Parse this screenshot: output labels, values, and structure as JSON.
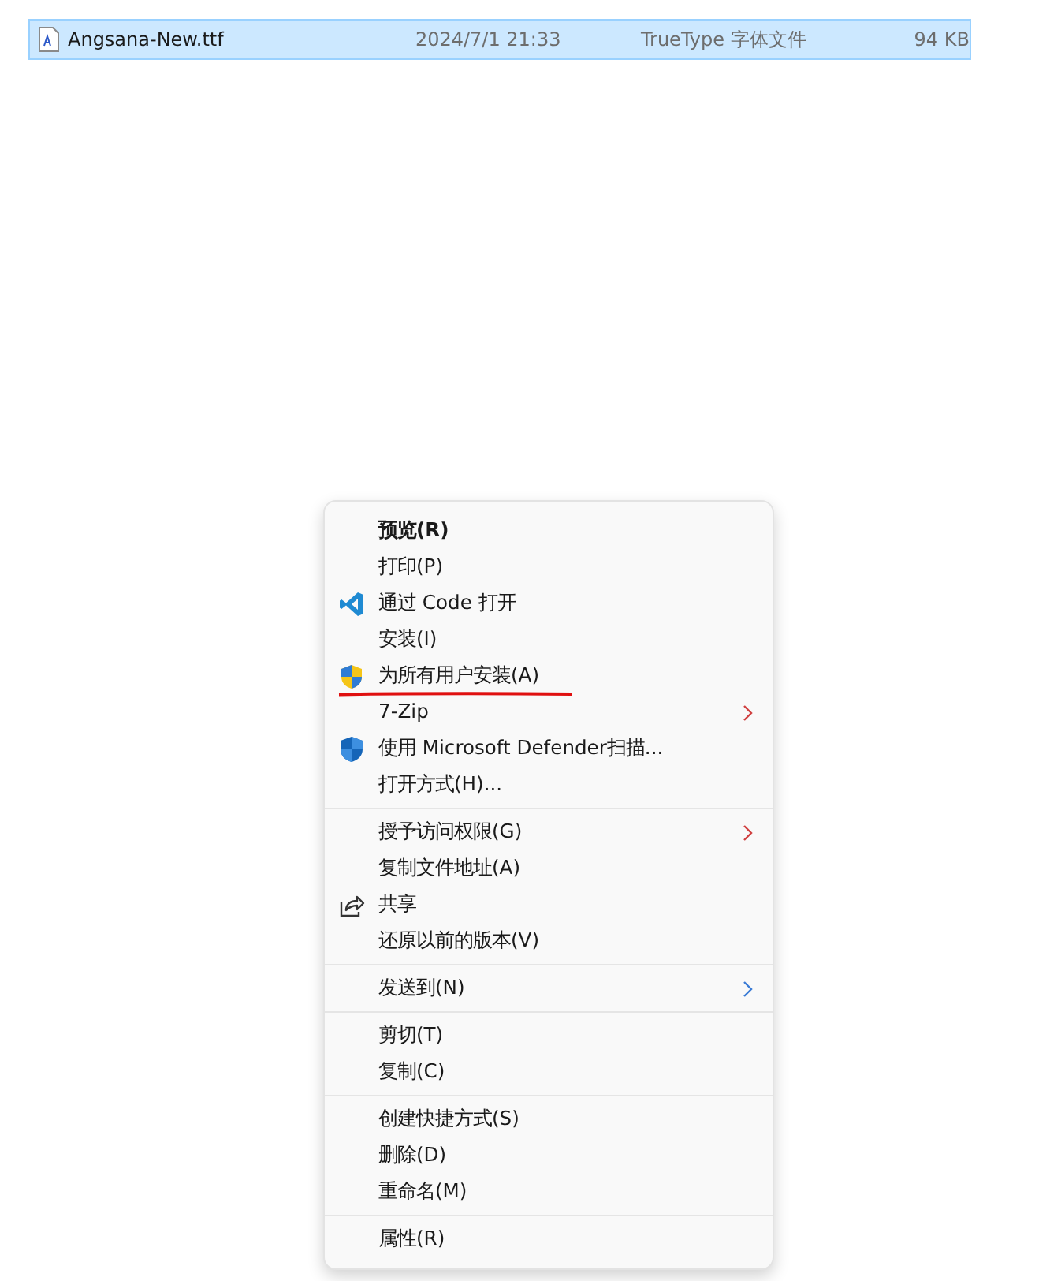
{
  "file_row": {
    "name": "Angsana-New.ttf",
    "modified": "2024/7/1 21:33",
    "type": "TrueType 字体文件",
    "size": "94 KB",
    "selected": true
  },
  "context_menu": {
    "groups": [
      {
        "items": [
          {
            "label": "预览(R)",
            "default": true,
            "kind": "plain"
          },
          {
            "label": "打印(P)",
            "default": false,
            "kind": "plain"
          },
          {
            "label": "通过 Code 打开",
            "default": false,
            "kind": "editor"
          },
          {
            "label": "安装(I)",
            "default": false,
            "kind": "plain"
          },
          {
            "label": "为所有用户安装(A)",
            "default": false,
            "kind": "uac",
            "underlined": true
          },
          {
            "label": "7-Zip",
            "default": false,
            "kind": "plain",
            "submenu": true
          },
          {
            "label": "使用 Microsoft Defender扫描...",
            "default": false,
            "kind": "defender"
          },
          {
            "label": "打开方式(H)...",
            "default": false,
            "kind": "plain"
          }
        ]
      },
      {
        "items": [
          {
            "label": "授予访问权限(G)",
            "default": false,
            "kind": "plain",
            "submenu": true
          },
          {
            "label": "复制文件地址(A)",
            "default": false,
            "kind": "plain"
          },
          {
            "label": "共享",
            "default": false,
            "kind": "share"
          },
          {
            "label": "还原以前的版本(V)",
            "default": false,
            "kind": "plain"
          }
        ]
      },
      {
        "items": [
          {
            "label": "发送到(N)",
            "default": false,
            "kind": "plain",
            "submenu": true
          }
        ]
      },
      {
        "items": [
          {
            "label": "剪切(T)",
            "default": false,
            "kind": "plain"
          },
          {
            "label": "复制(C)",
            "default": false,
            "kind": "plain"
          }
        ]
      },
      {
        "items": [
          {
            "label": "创建快捷方式(S)",
            "default": false,
            "kind": "plain"
          },
          {
            "label": "删除(D)",
            "default": false,
            "kind": "plain"
          },
          {
            "label": "重命名(M)",
            "default": false,
            "kind": "plain"
          }
        ]
      },
      {
        "items": [
          {
            "label": "属性(R)",
            "default": false,
            "kind": "plain"
          }
        ]
      }
    ]
  }
}
